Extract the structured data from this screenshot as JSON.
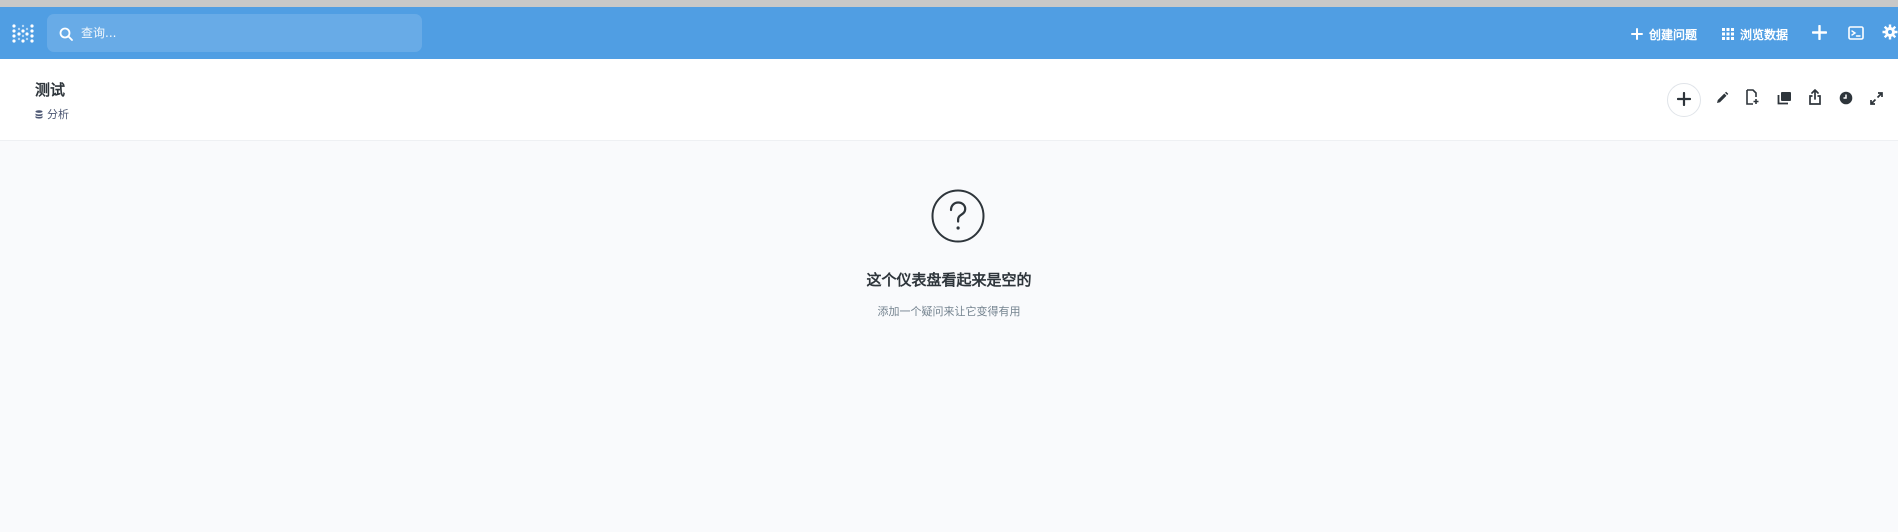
{
  "topnav": {
    "search": {
      "placeholder": "查询..."
    },
    "create_question_label": "创建问题",
    "browse_data_label": "浏览数据",
    "icons": [
      "logo-icon",
      "search-icon",
      "plus-icon",
      "grid-icon",
      "plus-icon",
      "terminal-icon",
      "gear-icon"
    ],
    "background": "#509ee3"
  },
  "dashboard": {
    "title": "测试",
    "collection_label": "分析",
    "header_actions": [
      "add-question",
      "edit",
      "new-document",
      "duplicate",
      "share",
      "history",
      "fullscreen"
    ]
  },
  "empty_state": {
    "title": "这个仪表盘看起来是空的",
    "subtitle": "添加一个疑问来让它变得有用"
  }
}
